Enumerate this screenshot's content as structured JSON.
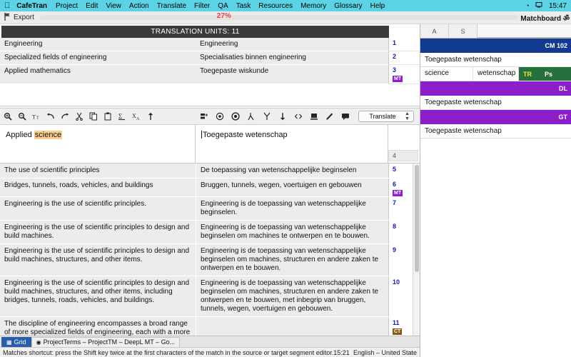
{
  "menubar": {
    "apple": "apple-logo",
    "app_name": "CafeTran",
    "items": [
      "Project",
      "Edit",
      "View",
      "Action",
      "Translate",
      "Filter",
      "QA",
      "Task",
      "Resources",
      "Memory",
      "Glossary",
      "Help"
    ],
    "clock": "15:47",
    "status_dot": "•",
    "battery_icon": "display-icon"
  },
  "exportbar": {
    "flag_icon": "flag-icon",
    "label": "Export",
    "progress_pct_label": "27%",
    "progress_value": 27,
    "matchboard_title": "Matchboard  ॐ"
  },
  "translation_units": {
    "header": "TRANSLATION UNITS: 11",
    "rows": [
      {
        "source": "Engineering",
        "target": "Engineering",
        "num": "1",
        "badge": ""
      },
      {
        "source": "Specialized fields of engineering",
        "target": "Specialisaties binnen engineering",
        "num": "2",
        "badge": ""
      },
      {
        "source": "Applied mathematics",
        "target": "Toegepaste wiskunde",
        "num": "3",
        "badge": "MT"
      }
    ]
  },
  "editor_toolbar": {
    "left_icons": [
      "zoom-in-icon",
      "zoom-out-icon",
      "font-size-icon",
      "undo-icon",
      "redo-icon",
      "cut-icon",
      "copy-icon",
      "paste-icon",
      "insert-tag-icon",
      "remove-tags-icon",
      "move-up-icon"
    ],
    "right_icons": [
      "insert-segment-icon",
      "target-match-icon",
      "target-match-filled-icon",
      "split-segment-icon",
      "merge-segment-icon",
      "insert-down-icon",
      "code-tags-icon",
      "lock-segment-icon",
      "edit-pencil-icon",
      "comment-icon"
    ],
    "action_select": {
      "value": "Translate",
      "options": [
        "Translate"
      ]
    }
  },
  "current_segment": {
    "source_prefix": "Applied ",
    "source_highlight": "science",
    "target": "Toegepaste wetenschap",
    "num": "4"
  },
  "segment_grid": {
    "rows": [
      {
        "source": "The use of scientific principles",
        "target": "De toepassing van wetenschappelijke beginselen",
        "num": "5",
        "badge": ""
      },
      {
        "source": "Bridges, tunnels, roads, vehicles, and buildings",
        "target": "Bruggen, tunnels, wegen, voertuigen en gebouwen",
        "num": "6",
        "badge": "MT"
      },
      {
        "source": "Engineering is the use of scientific principles.",
        "target": "Engineering is de toepassing van wetenschappelijke beginselen.",
        "num": "7",
        "badge": ""
      },
      {
        "source": "Engineering is the use of scientific principles to design and build machines.",
        "target": "Engineering is de toepassing van wetenschappelijke beginselen om machines te ontwerpen en te bouwen.",
        "num": "8",
        "badge": ""
      },
      {
        "source": "Engineering is the use of scientific principles to design and build machines, structures, and other items.",
        "target": "Engineering is de toepassing van wetenschappelijke beginselen om machines, structuren en andere zaken te ontwerpen en te bouwen.",
        "num": "9",
        "badge": ""
      },
      {
        "source": "Engineering is the use of scientific principles to design and build machines, structures, and other items, including bridges, tunnels, roads, vehicles, and buildings.",
        "target": "Engineering is de toepassing van wetenschappelijke beginselen om machines, structuren en andere zaken te ontwerpen en te bouwen, met inbegrip van bruggen, tunnels, wegen, voertuigen en gebouwen.",
        "num": "10",
        "badge": ""
      },
      {
        "source": "The discipline of engineering encompasses a broad range of more specialized fields of engineering, each with a more specific emphasis on particular areas of applied mathematics, applied science, and types of application",
        "target": "",
        "num": "11",
        "badge": "CT"
      }
    ]
  },
  "tabbar": {
    "tabs": [
      {
        "label": "Grid",
        "icon": "grid-icon",
        "active": true
      },
      {
        "label": "ProjectTerms – ProjectTM – DeepL MT – Go...",
        "icon": "globe-icon",
        "active": false
      }
    ]
  },
  "statusbar": {
    "message": "Matches shortcut: press the Shift key twice at the first characters of the match in the source or target segment editor.15:21",
    "language": "English – United State"
  },
  "matchboard": {
    "tabs": [
      "A",
      "S"
    ],
    "entries": [
      {
        "type": "bar",
        "kind": "cm",
        "label": "CM 102"
      },
      {
        "type": "text",
        "text": "Toegepaste wetenschap"
      },
      {
        "type": "term",
        "source": "science",
        "target": "wetenschap",
        "flag1": "TR",
        "flag2": "Ps"
      },
      {
        "type": "bar",
        "kind": "dl",
        "label": "DL"
      },
      {
        "type": "text",
        "text": "Toegepaste wetenschap"
      },
      {
        "type": "bar",
        "kind": "gt",
        "label": "GT"
      },
      {
        "type": "text",
        "text": "Toegepaste wetenschap"
      }
    ]
  },
  "colors": {
    "menubar_bg": "#5bd3e4",
    "cm_bar": "#123a8f",
    "mt_bar": "#8c1fc9",
    "term_green": "#26703f",
    "progress_red": "#ef3b3b",
    "highlight": "#f8cf8f",
    "tab_active": "#2a5caa"
  }
}
